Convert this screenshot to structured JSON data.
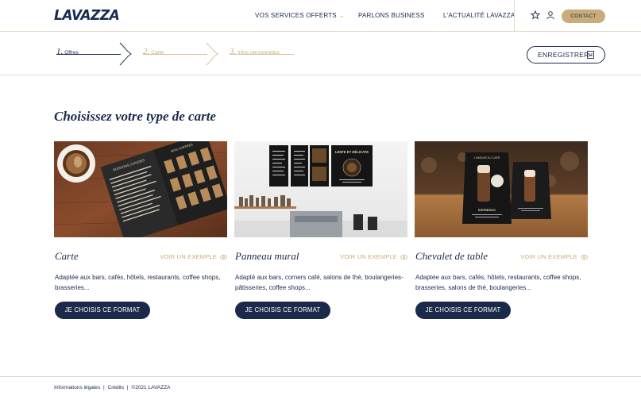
{
  "brand": {
    "logo": "LAVAZZA"
  },
  "nav": {
    "services": "VOS SERVICES OFFERTS",
    "business": "PARLONS BUSINESS",
    "news": "L'ACTUALITÉ LAVAZZA",
    "contact": "CONTACT"
  },
  "steps": [
    {
      "num": "1.",
      "label": "Offres"
    },
    {
      "num": "2.",
      "label": "Carte"
    },
    {
      "num": "3.",
      "label": "Infos personnelles"
    }
  ],
  "save_button": "ENREGISTRER",
  "page_title": "Choisissez votre type de carte",
  "cards": [
    {
      "title": "Carte",
      "example": "VOIR UN EXEMPLE",
      "desc": "Adaptée aux bars, cafés, hôtels, restaurants, coffee shops, brasseries...",
      "button": "JE CHOISIS CE FORMAT"
    },
    {
      "title": "Panneau mural",
      "example": "VOIR UN EXEMPLE",
      "desc": "Adapté aux bars, corners café, salons de thé, boulangeries- pâtisseries, coffee shops...",
      "button": "JE CHOISIS CE FORMAT"
    },
    {
      "title": "Chevalet de table",
      "example": "VOIR UN EXEMPLE",
      "desc": "Adaptée aux bars, cafés, hôtels, restaurants, coffee shops, brasseries, salons de thé, boulangeries...",
      "button": "JE CHOISIS CE FORMAT"
    }
  ],
  "mockups": {
    "menu_header": "BOISSONS CHAUDES",
    "menu_header2": "NOS COFFEES ",
    "wall_panel": "LENTE ET DÉLICATE",
    "tent_top": "L'AMOUR DU CAFÉ",
    "tent_bottom": "ESPRESSO"
  },
  "footer": {
    "legal": "Informations légales",
    "credits": "Crédits",
    "copyright": "©2021  LAVAZZA"
  },
  "colors": {
    "navy": "#1b2a4a",
    "gold": "#c8ac79",
    "divider": "#e3d7c3"
  }
}
